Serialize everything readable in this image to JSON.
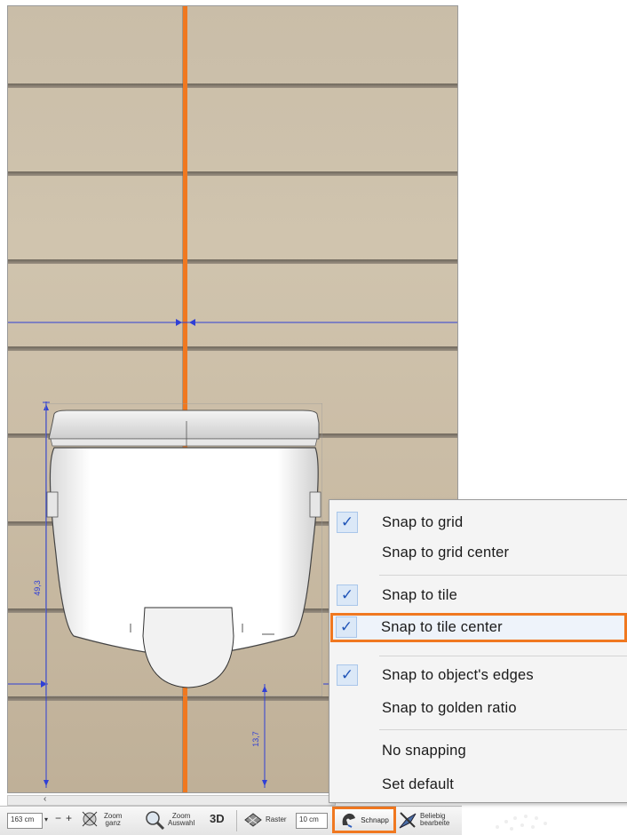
{
  "canvas": {
    "dim_horizontal_marker": "",
    "dim_height_label": "49,3",
    "dim_bottom_label": "13,7"
  },
  "toolbar": {
    "width_value": "163 cm",
    "zoom_all_label": "Zoom\nganz",
    "zoom_selection_label": "Zoom\nAuswahl",
    "view_3d_label": "3D",
    "grid_label": "Raster",
    "grid_value": "10 cm",
    "snap_label": "Schnapp",
    "edit_label": "Beliebig\nbearbeite"
  },
  "snap_menu": {
    "items": [
      {
        "label": "Snap to grid",
        "checked": true
      },
      {
        "label": "Snap to grid center",
        "checked": false
      },
      {
        "label": "Snap to tile",
        "checked": true
      },
      {
        "label": "Snap to tile center",
        "checked": true
      },
      {
        "label": "Snap to object's edges",
        "checked": true
      },
      {
        "label": "Snap to golden ratio",
        "checked": false
      },
      {
        "label": "No snapping",
        "checked": false
      },
      {
        "label": "Set default",
        "checked": false
      }
    ],
    "check_glyph": "✓"
  },
  "colors": {
    "accent": "#f07820",
    "dimension": "#2f3fd6",
    "menu_check_bg": "#dbe8f7"
  }
}
